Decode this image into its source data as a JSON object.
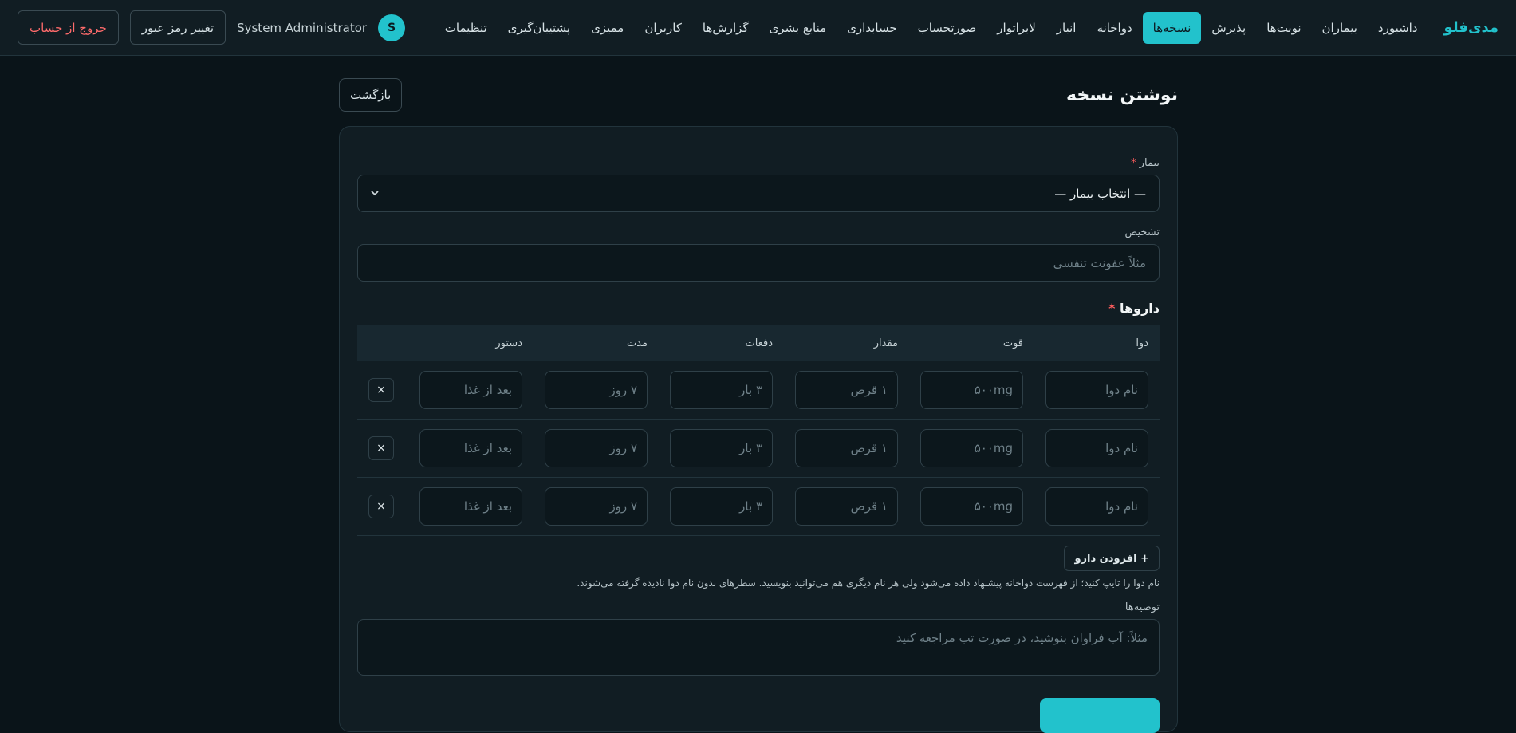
{
  "nav": {
    "brand": "مدی‌فلو",
    "items": [
      {
        "label": "داشبورد",
        "name": "nav-dashboard",
        "active": false
      },
      {
        "label": "بیماران",
        "name": "nav-patients",
        "active": false
      },
      {
        "label": "نوبت‌ها",
        "name": "nav-appointments",
        "active": false
      },
      {
        "label": "پذیرش",
        "name": "nav-admission",
        "active": false
      },
      {
        "label": "نسخه‌ها",
        "name": "nav-prescriptions",
        "active": true
      },
      {
        "label": "دواخانه",
        "name": "nav-pharmacy",
        "active": false
      },
      {
        "label": "انبار",
        "name": "nav-warehouse",
        "active": false
      },
      {
        "label": "لابراتوار",
        "name": "nav-laboratory",
        "active": false
      },
      {
        "label": "صورتحساب",
        "name": "nav-billing",
        "active": false
      },
      {
        "label": "حسابداری",
        "name": "nav-accounting",
        "active": false
      },
      {
        "label": "منابع بشری",
        "name": "nav-hr",
        "active": false
      },
      {
        "label": "گزارش‌ها",
        "name": "nav-reports",
        "active": false
      },
      {
        "label": "کاربران",
        "name": "nav-users",
        "active": false
      },
      {
        "label": "ممیزی",
        "name": "nav-audit",
        "active": false
      },
      {
        "label": "پشتیبان‌گیری",
        "name": "nav-backup",
        "active": false
      },
      {
        "label": "تنظیمات",
        "name": "nav-settings",
        "active": false
      }
    ],
    "user_initial": "S",
    "user_name": "System Administrator",
    "change_password": "تغییر رمز عبور",
    "logout": "خروج از حساب"
  },
  "page": {
    "title": "نوشتن نسخه",
    "back": "بازگشت"
  },
  "form": {
    "patient_label": "بیمار",
    "patient_required": "*",
    "patient_value": "— انتخاب بیمار —",
    "diagnosis_label": "تشخیص",
    "diagnosis_placeholder": "مثلاً عفونت تنفسی",
    "meds_title": "داروها",
    "meds_required": "*",
    "columns": [
      "دوا",
      "قوت",
      "مقدار",
      "دفعات",
      "مدت",
      "دستور"
    ],
    "rows": [
      [
        "نام دوا",
        "۵۰۰mg",
        "۱ قرص",
        "۳ بار",
        "۷ روز",
        "بعد از غذا"
      ],
      [
        "نام دوا",
        "۵۰۰mg",
        "۱ قرص",
        "۳ بار",
        "۷ روز",
        "بعد از غذا"
      ],
      [
        "نام دوا",
        "۵۰۰mg",
        "۱ قرص",
        "۳ بار",
        "۷ روز",
        "بعد از غذا"
      ]
    ],
    "delete_glyph": "×",
    "add_med": "+ افزودن دارو",
    "hint": "نام دوا را تایپ کنید؛ از فهرست دواخانه پیشنهاد داده می‌شود ولی هر نام دیگری هم می‌توانید بنویسید. سطرهای بدون نام دوا نادیده گرفته می‌شوند.",
    "advice_label": "توصیه‌ها",
    "advice_placeholder": "مثلاً: آب فراوان بنوشید، در صورت تب مراجعه کنید"
  },
  "colors": {
    "accent": "#22c2cc",
    "danger": "#ff6b6b",
    "background": "#0a1419"
  }
}
